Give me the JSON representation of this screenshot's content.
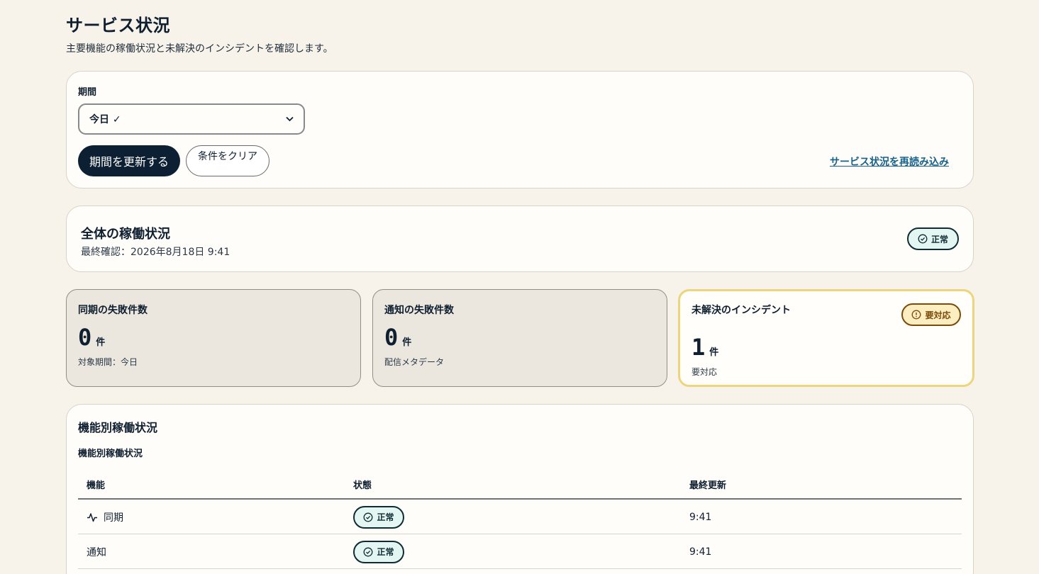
{
  "page": {
    "title": "サービス状況",
    "description": "主要機能の稼働状況と未解決のインシデントを確認します。"
  },
  "filter": {
    "label": "期間",
    "selected": "今日 ✓",
    "apply_label": "期間を更新する",
    "clear_label": "条件をクリア",
    "reload_label": "サービス状況を再読み込み"
  },
  "overall": {
    "title": "全体の稼働状況",
    "last_checked": "最終確認：2026年8月18日 9:41",
    "status": "正常"
  },
  "stats": [
    {
      "title": "同期の失敗件数",
      "value": "0",
      "unit": "件",
      "sub": "対象期間：今日"
    },
    {
      "title": "通知の失敗件数",
      "value": "0",
      "unit": "件",
      "sub": "配信メタデータ"
    },
    {
      "title": "未解決のインシデント",
      "value": "1",
      "unit": "件",
      "sub": "要対応",
      "badge": "要対応"
    }
  ],
  "functions": {
    "title": "機能別稼働状況",
    "caption": "機能別稼働状況",
    "columns": [
      "機能",
      "状態",
      "最終更新"
    ],
    "rows": [
      {
        "name": "同期",
        "status": "正常",
        "updated": "9:41",
        "icon": "activity-icon"
      },
      {
        "name": "通知",
        "status": "正常",
        "updated": "9:41"
      }
    ]
  },
  "colors": {
    "background": "#f7f3ea",
    "primary": "#0d1f33",
    "link": "#17628b",
    "ok_bg": "#e4f6f2",
    "warn_bg": "#fdeec2",
    "warn_border": "#ecd57d"
  }
}
